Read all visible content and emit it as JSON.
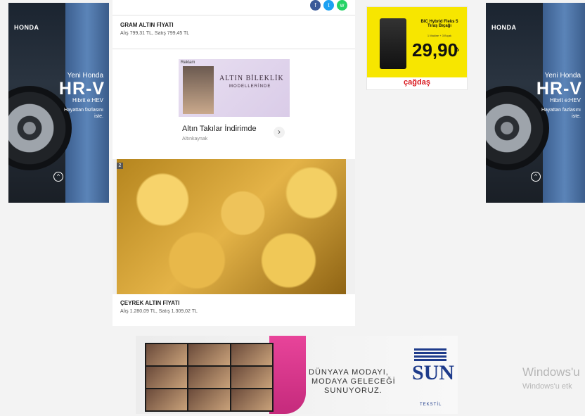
{
  "left_ad": {
    "brand": "HONDA",
    "line1": "Yeni Honda",
    "model": "HR-V",
    "hybrid": "Hibrit e:HEV",
    "tagline": "Hayattan fazlasını iste.",
    "up": "^"
  },
  "right_ad": {
    "brand": "HONDA",
    "line1": "Yeni Honda",
    "model": "HR-V",
    "hybrid": "Hibrit e:HEV",
    "tagline": "Hayattan fazlasını iste.",
    "up": "^"
  },
  "share": {
    "facebook": "f",
    "twitter": "t",
    "whatsapp": "w"
  },
  "gram": {
    "title": "GRAM ALTIN FİYATI",
    "price": "Alış 799,31 TL, Satış 799,45 TL"
  },
  "inline_ad": {
    "sponsor": "Reklam",
    "headline": "ALTIN BİLEKLİK",
    "sub": "MODELLERİNDE",
    "title": "Altın Takılar İndirimde",
    "source": "Altınkaynak",
    "arrow": "›"
  },
  "ceyrek": {
    "title": "ÇEYREK ALTIN FİYATI",
    "price": "Alış 1.280,09 TL, Satış 1.309,02 TL",
    "index": "2"
  },
  "cagdas_ad": {
    "product": "BIC Hybrid Fleks 5 Tıraş Bıçağı",
    "note": "1 Makine + 3 Bıçak",
    "price": "29,90",
    "currency": "₺",
    "brand": "çağdaş"
  },
  "sun_ad": {
    "slogan1": "DÜNYAYA MODAYI,",
    "slogan2": "MODAYA GELECEĞİ",
    "slogan3": "SUNUYORUZ.",
    "brand": "SUN",
    "sub": "TEKSTİL"
  },
  "windows": {
    "line1": "Windows'u",
    "line2": "Windows'u etk"
  },
  "colors": {
    "facebook": "#3b5998",
    "twitter": "#1da1f2",
    "whatsapp": "#25d366",
    "cagdas_red": "#d9161c",
    "sun_blue": "#1e3b8b"
  }
}
